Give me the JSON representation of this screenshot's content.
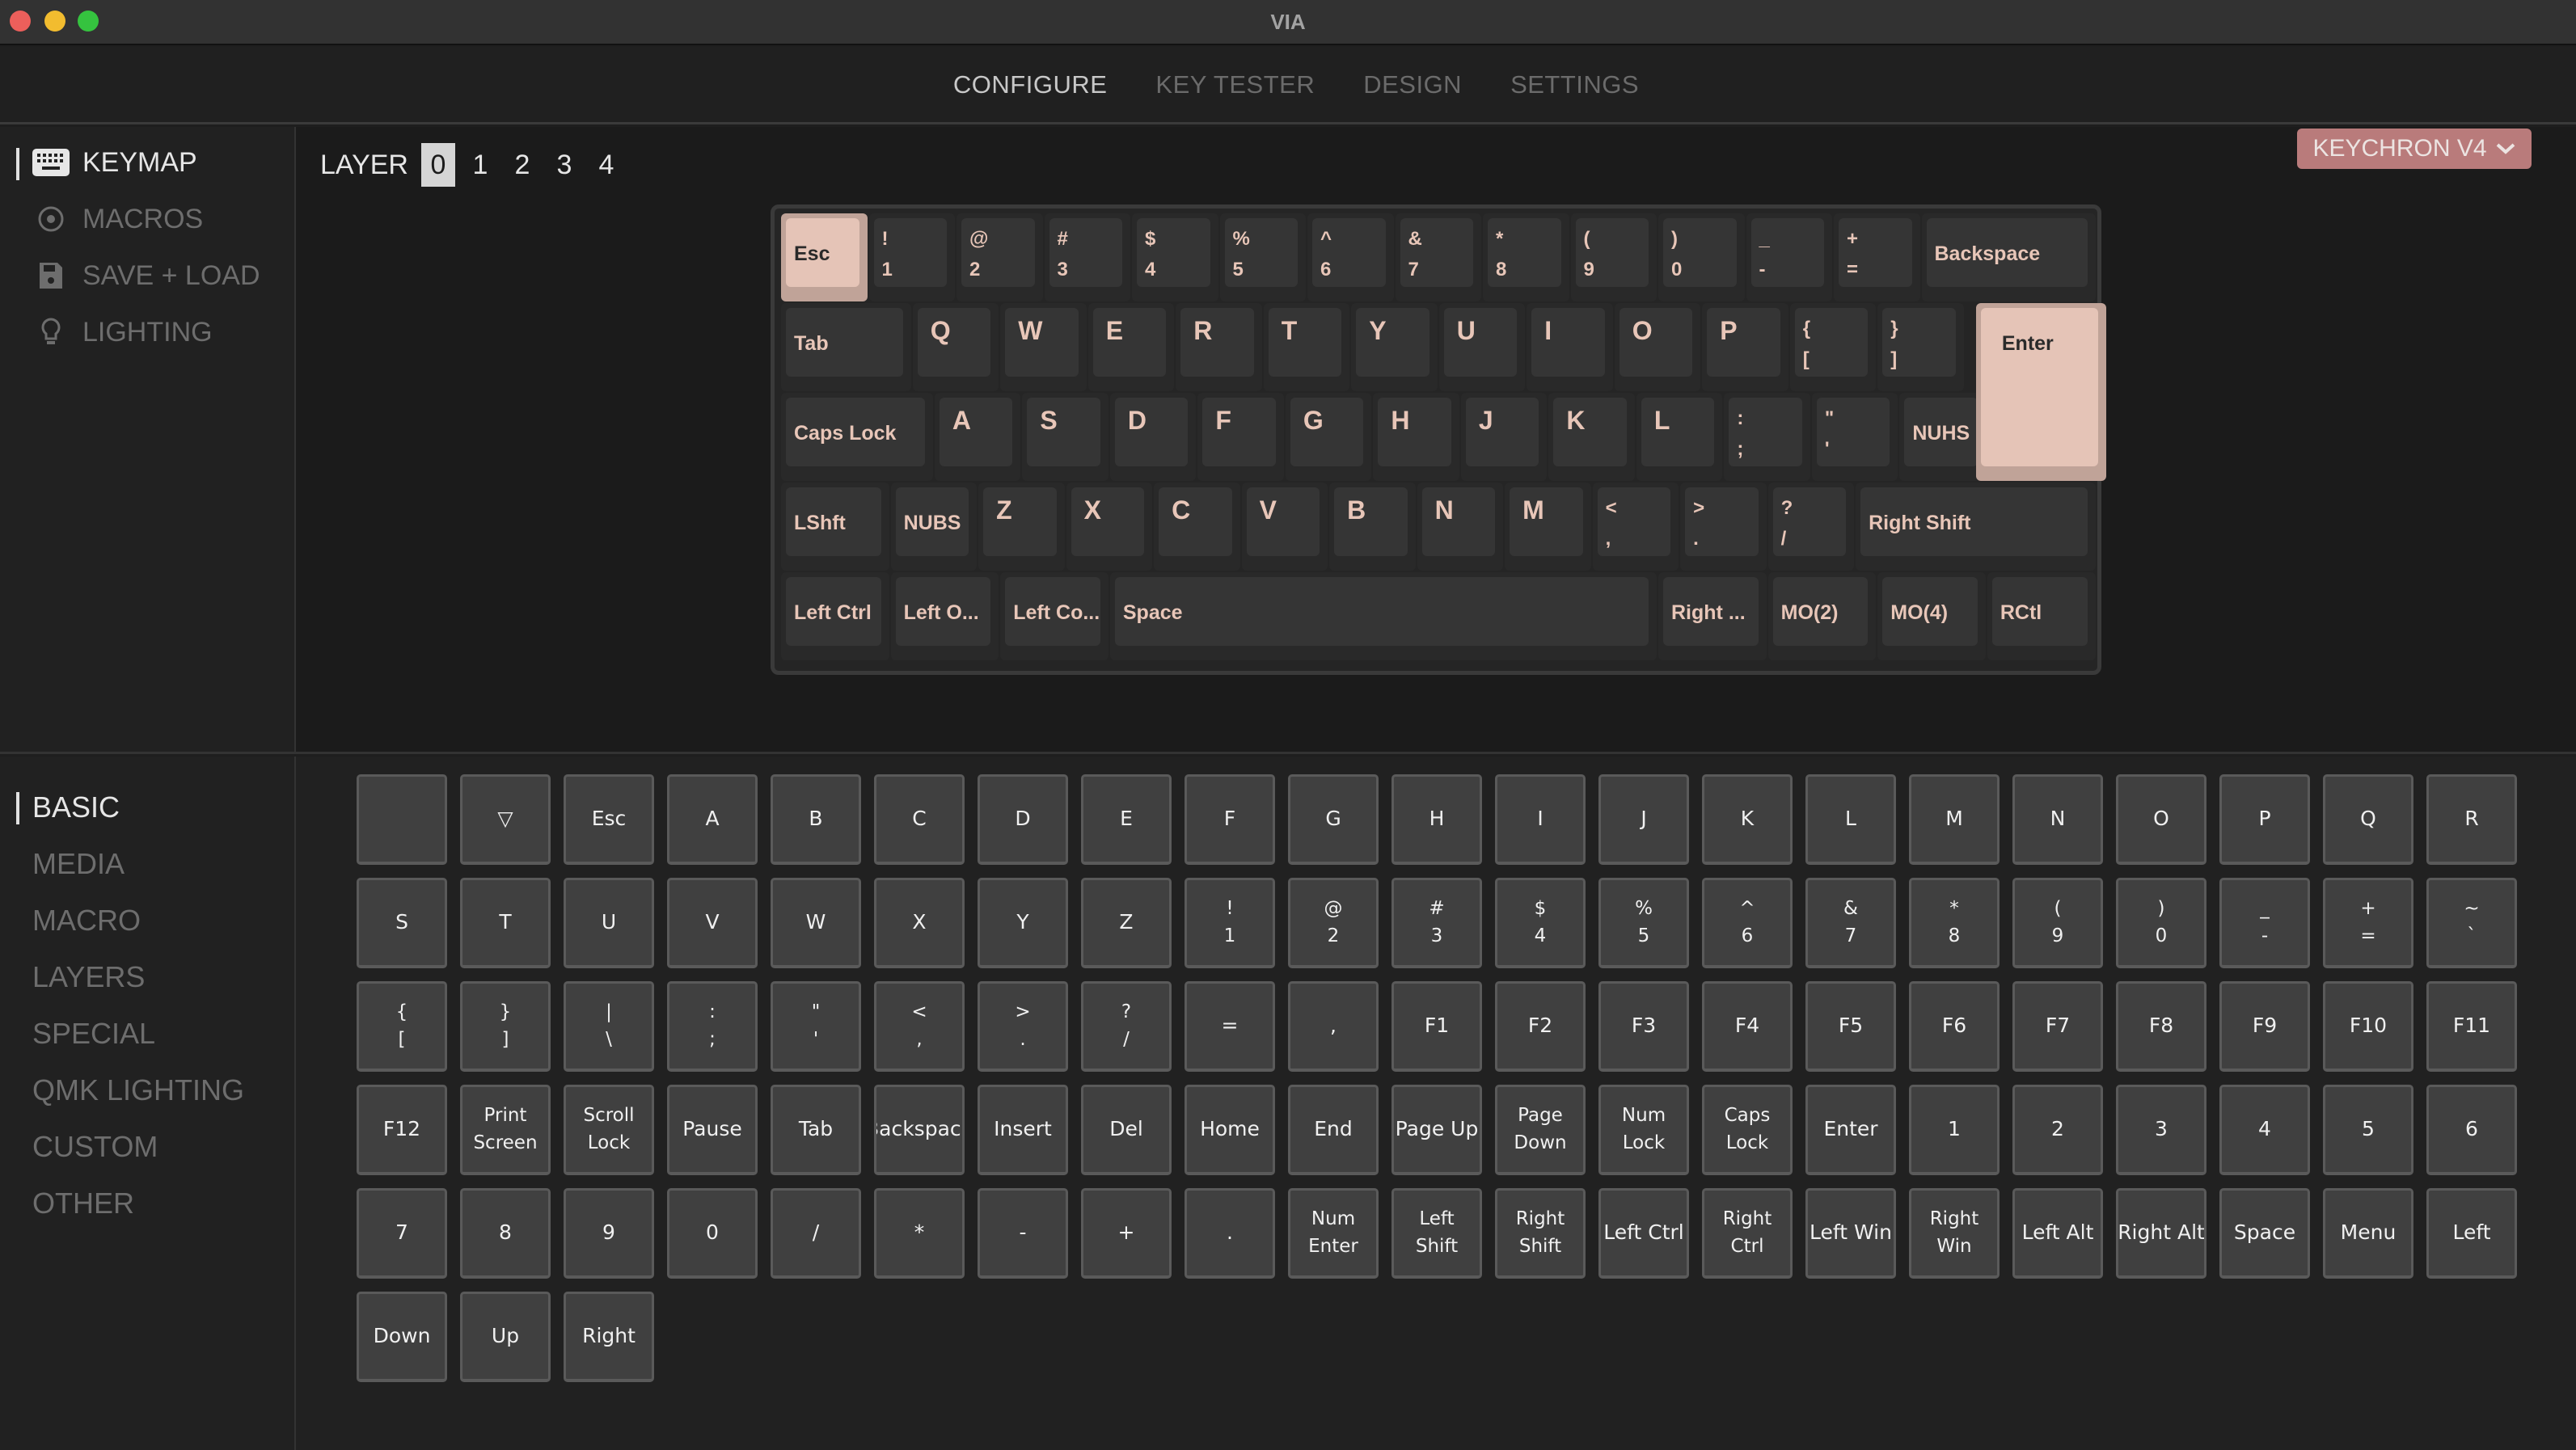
{
  "window": {
    "title": "VIA"
  },
  "nav": {
    "tabs": [
      "CONFIGURE",
      "KEY TESTER",
      "DESIGN",
      "SETTINGS"
    ],
    "active": 0
  },
  "menu": {
    "items": [
      {
        "label": "KEYMAP",
        "icon": "keyboard-icon"
      },
      {
        "label": "MACROS",
        "icon": "record-icon"
      },
      {
        "label": "SAVE + LOAD",
        "icon": "save-icon"
      },
      {
        "label": "LIGHTING",
        "icon": "bulb-icon"
      }
    ],
    "active": 0
  },
  "layers": {
    "label": "LAYER",
    "values": [
      "0",
      "1",
      "2",
      "3",
      "4"
    ],
    "active": "0"
  },
  "device": {
    "name": "KEYCHRON V4"
  },
  "colors": {
    "accent": "#b97b7b",
    "keycap_text": "#e8c6b8",
    "selected_key": "#e5c4b7"
  },
  "keyboard": {
    "rows": [
      [
        {
          "top": "Esc",
          "w": 1,
          "sel": true
        },
        {
          "top": "!",
          "bot": "1"
        },
        {
          "top": "@",
          "bot": "2"
        },
        {
          "top": "#",
          "bot": "3"
        },
        {
          "top": "$",
          "bot": "4"
        },
        {
          "top": "%",
          "bot": "5"
        },
        {
          "top": "^",
          "bot": "6"
        },
        {
          "top": "&",
          "bot": "7"
        },
        {
          "top": "*",
          "bot": "8"
        },
        {
          "top": "(",
          "bot": "9"
        },
        {
          "top": ")",
          "bot": "0"
        },
        {
          "top": "_",
          "bot": "-"
        },
        {
          "top": "+",
          "bot": "="
        },
        {
          "label": "Backspace",
          "w": 2
        }
      ],
      [
        {
          "label": "Tab",
          "w": 1.5
        },
        {
          "big": "Q"
        },
        {
          "big": "W"
        },
        {
          "big": "E"
        },
        {
          "big": "R"
        },
        {
          "big": "T"
        },
        {
          "big": "Y"
        },
        {
          "big": "U"
        },
        {
          "big": "I"
        },
        {
          "big": "O"
        },
        {
          "big": "P"
        },
        {
          "top": "{",
          "bot": "["
        },
        {
          "top": "}",
          "bot": "]"
        }
      ],
      [
        {
          "label": "Caps Lock",
          "w": 1.75
        },
        {
          "big": "A"
        },
        {
          "big": "S"
        },
        {
          "big": "D"
        },
        {
          "big": "F"
        },
        {
          "big": "G"
        },
        {
          "big": "H"
        },
        {
          "big": "J"
        },
        {
          "big": "K"
        },
        {
          "big": "L"
        },
        {
          "top": ":",
          "bot": ";"
        },
        {
          "top": "\"",
          "bot": "'"
        },
        {
          "label": "NUHS"
        }
      ],
      [
        {
          "label": "LShft",
          "w": 1.25
        },
        {
          "label": "NUBS"
        },
        {
          "big": "Z"
        },
        {
          "big": "X"
        },
        {
          "big": "C"
        },
        {
          "big": "V"
        },
        {
          "big": "B"
        },
        {
          "big": "N"
        },
        {
          "big": "M"
        },
        {
          "top": "<",
          "bot": ","
        },
        {
          "top": ">",
          "bot": "."
        },
        {
          "top": "?",
          "bot": "/"
        },
        {
          "label": "Right Shift",
          "w": 2.75
        }
      ],
      [
        {
          "label": "Left Ctrl",
          "w": 1.25
        },
        {
          "label": "Left O...",
          "w": 1.25
        },
        {
          "label": "Left Co...",
          "w": 1.25
        },
        {
          "label": "Space",
          "w": 6.25
        },
        {
          "label": "Right ...",
          "w": 1.25
        },
        {
          "label": "MO(2)",
          "w": 1.25
        },
        {
          "label": "MO(4)",
          "w": 1.25
        },
        {
          "label": "RCtl",
          "w": 1.25
        }
      ]
    ],
    "enter": {
      "label": "Enter",
      "sel": true
    }
  },
  "categories": {
    "items": [
      "BASIC",
      "MEDIA",
      "MACRO",
      "LAYERS",
      "SPECIAL",
      "QMK LIGHTING",
      "CUSTOM",
      "OTHER"
    ],
    "active": 0
  },
  "palette": [
    [
      ""
    ],
    [
      "▽"
    ],
    [
      "Esc"
    ],
    [
      "A"
    ],
    [
      "B"
    ],
    [
      "C"
    ],
    [
      "D"
    ],
    [
      "E"
    ],
    [
      "F"
    ],
    [
      "G"
    ],
    [
      "H"
    ],
    [
      "I"
    ],
    [
      "J"
    ],
    [
      "K"
    ],
    [
      "L"
    ],
    [
      "M"
    ],
    [
      "N"
    ],
    [
      "O"
    ],
    [
      "P"
    ],
    [
      "Q"
    ],
    [
      "R"
    ],
    [
      "S"
    ],
    [
      "T"
    ],
    [
      "U"
    ],
    [
      "V"
    ],
    [
      "W"
    ],
    [
      "X"
    ],
    [
      "Y"
    ],
    [
      "Z"
    ],
    [
      "!",
      "1"
    ],
    [
      "@",
      "2"
    ],
    [
      "#",
      "3"
    ],
    [
      "$",
      "4"
    ],
    [
      "%",
      "5"
    ],
    [
      "^",
      "6"
    ],
    [
      "&",
      "7"
    ],
    [
      "*",
      "8"
    ],
    [
      "(",
      "9"
    ],
    [
      ")",
      "0"
    ],
    [
      "_",
      "-"
    ],
    [
      "+",
      "="
    ],
    [
      "~",
      "`"
    ],
    [
      "{",
      "["
    ],
    [
      "}",
      "]"
    ],
    [
      "|",
      "\\"
    ],
    [
      ":",
      ";"
    ],
    [
      "\"",
      "'"
    ],
    [
      "<",
      ","
    ],
    [
      ">",
      "."
    ],
    [
      "?",
      "/"
    ],
    [
      "="
    ],
    [
      ","
    ],
    [
      "F1"
    ],
    [
      "F2"
    ],
    [
      "F3"
    ],
    [
      "F4"
    ],
    [
      "F5"
    ],
    [
      "F6"
    ],
    [
      "F7"
    ],
    [
      "F8"
    ],
    [
      "F9"
    ],
    [
      "F10"
    ],
    [
      "F11"
    ],
    [
      "F12"
    ],
    [
      "Print",
      "Screen"
    ],
    [
      "Scroll",
      "Lock"
    ],
    [
      "Pause"
    ],
    [
      "Tab"
    ],
    [
      "Backspace"
    ],
    [
      "Insert"
    ],
    [
      "Del"
    ],
    [
      "Home"
    ],
    [
      "End"
    ],
    [
      "Page Up"
    ],
    [
      "Page",
      "Down"
    ],
    [
      "Num",
      "Lock"
    ],
    [
      "Caps",
      "Lock"
    ],
    [
      "Enter"
    ],
    [
      "1"
    ],
    [
      "2"
    ],
    [
      "3"
    ],
    [
      "4"
    ],
    [
      "5"
    ],
    [
      "6"
    ],
    [
      "7"
    ],
    [
      "8"
    ],
    [
      "9"
    ],
    [
      "0"
    ],
    [
      "/"
    ],
    [
      "*"
    ],
    [
      "-"
    ],
    [
      "+"
    ],
    [
      "."
    ],
    [
      "Num",
      "Enter"
    ],
    [
      "Left",
      "Shift"
    ],
    [
      "Right",
      "Shift"
    ],
    [
      "Left Ctrl"
    ],
    [
      "Right",
      "Ctrl"
    ],
    [
      "Left Win"
    ],
    [
      "Right",
      "Win"
    ],
    [
      "Left Alt"
    ],
    [
      "Right Alt"
    ],
    [
      "Space"
    ],
    [
      "Menu"
    ],
    [
      "Left"
    ],
    [
      "Down"
    ],
    [
      "Up"
    ],
    [
      "Right"
    ]
  ]
}
